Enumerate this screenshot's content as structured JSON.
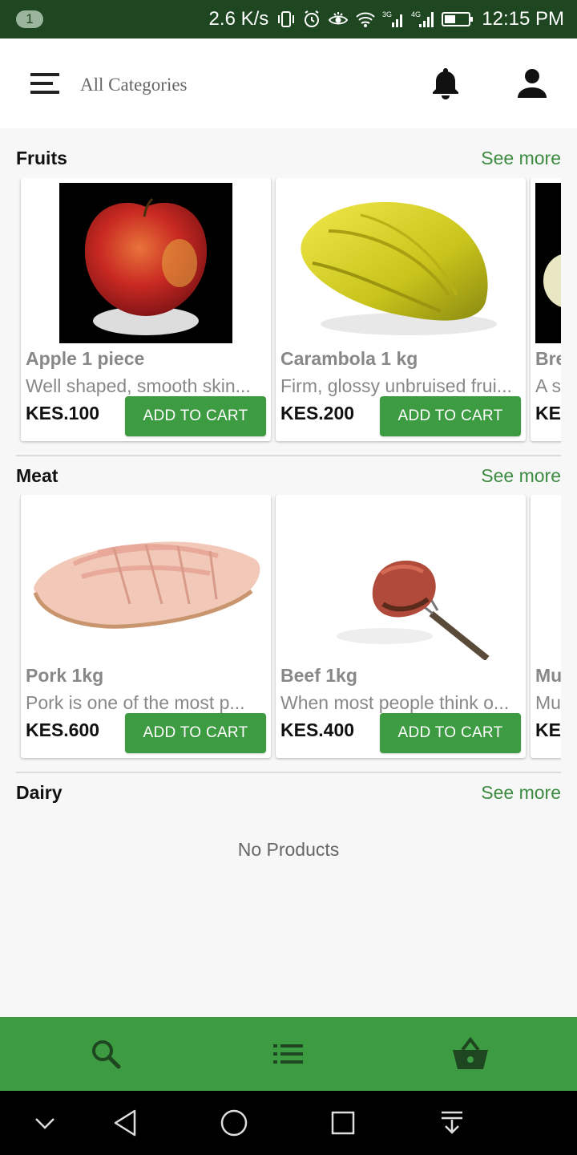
{
  "status_bar": {
    "notification_count": "1",
    "speed": "2.6 K/s",
    "time": "12:15 PM",
    "icons": [
      "vibrate-icon",
      "alarm-icon",
      "eye-icon",
      "wifi-icon",
      "signal-3g-icon",
      "signal-4g-icon",
      "battery-icon"
    ],
    "net_3g": "3G",
    "net_4g": "4G"
  },
  "header": {
    "title": "All Categories",
    "menu_icon": "hamburger-menu-icon",
    "notification_icon": "bell-icon",
    "profile_icon": "user-icon"
  },
  "sections": [
    {
      "title": "Fruits",
      "see_more": "See more",
      "products": [
        {
          "name": "Apple 1 piece",
          "description": "Well shaped, smooth skin...",
          "price": "KES.100",
          "button": "ADD TO CART",
          "image": "apple"
        },
        {
          "name": "Carambola 1 kg",
          "description": "Firm, glossy unbruised frui...",
          "price": "KES.200",
          "button": "ADD TO CART",
          "image": "carambola"
        },
        {
          "name": "Bre",
          "description": "A s",
          "price": "KE",
          "button": "",
          "image": "bread-partial"
        }
      ]
    },
    {
      "title": "Meat",
      "see_more": "See more",
      "products": [
        {
          "name": "Pork 1kg",
          "description": "Pork is one of the most p...",
          "price": "KES.600",
          "button": "ADD TO CART",
          "image": "pork"
        },
        {
          "name": "Beef 1kg",
          "description": "When most people think o...",
          "price": "KES.400",
          "button": "ADD TO CART",
          "image": "beef"
        },
        {
          "name": "Mu",
          "description": "Mu",
          "price": "KE",
          "button": "",
          "image": "mutton-partial"
        }
      ]
    },
    {
      "title": "Dairy",
      "see_more": "See more",
      "empty_text": "No Products"
    }
  ],
  "bottom_nav": {
    "items": [
      "search-icon",
      "list-icon",
      "basket-icon"
    ],
    "accent": "#3d9b42",
    "icon_color": "#1e4620"
  },
  "system_nav": {
    "items": [
      "chevron-down-icon",
      "back-icon",
      "home-icon",
      "recents-icon",
      "notification-pull-icon"
    ]
  },
  "colors": {
    "status_bar": "#1e4620",
    "accent": "#3d9b42",
    "link": "#3d8b40"
  }
}
